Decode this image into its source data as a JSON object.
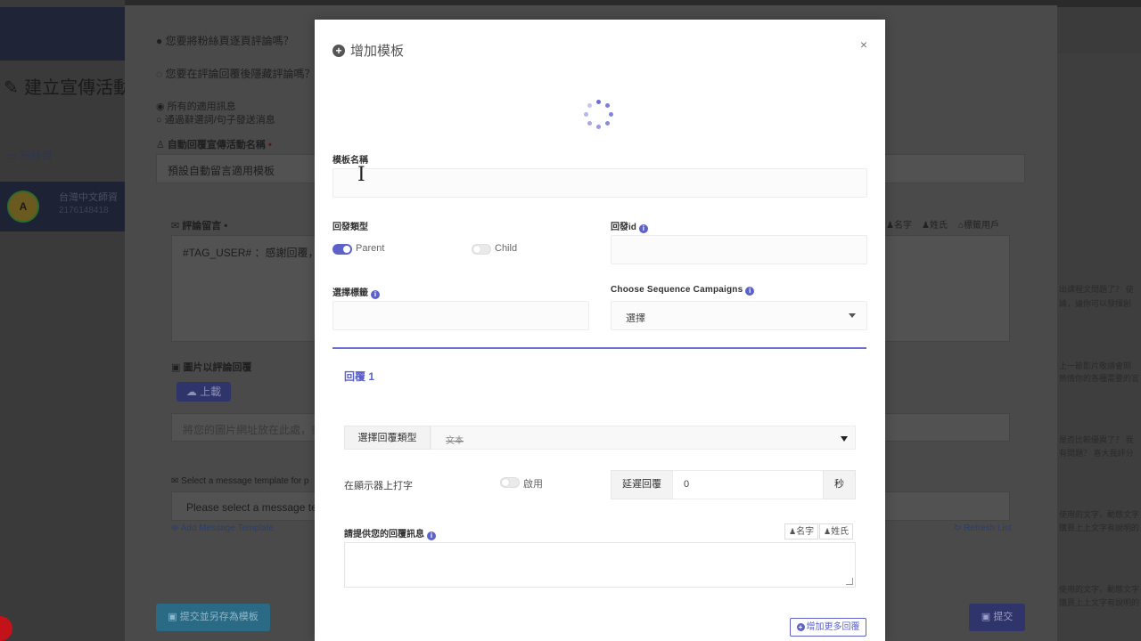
{
  "background": {
    "page_title": "建立宣傳活動",
    "fanpage_label": "粉絲頁",
    "account": {
      "initial": "A",
      "name": "台灣中文師資",
      "id": "2176148418"
    },
    "q_hide_reply": "您要在評論回覆後隱藏評論嗎？",
    "q_reply_page": "您要將粉絲頁逐頁評論嗎？",
    "radio_all": "所有的適用訊息",
    "radio_keyword": "通過辭選詞/句子發送消息",
    "campaign_name_label": "自動回覆宣傳活動名稱",
    "campaign_name_value": "預設自動留言適用模板",
    "comment_label": "評論留言",
    "comment_value": "#TAG_USER# ：感謝回覆，請",
    "tag_buttons": [
      "名字",
      "姓氏",
      "標籤用戶"
    ],
    "image_reply_label": "圖片以評論回覆",
    "upload_label": "上載",
    "image_url_placeholder": "將您的圖片網址放在此處，或",
    "template_label": "Select a message template for p",
    "template_placeholder": "Please select a message temp",
    "add_template_link": "Add Message Template",
    "refresh_link": "Refresh List",
    "save_as_template_button": "提交並另存為模板",
    "submit_button": "提交",
    "right_snippets": [
      "出課程文問題了？ 使",
      "論，讓你可以發揮創",
      "上一節影片敬請會期",
      "熱情你的各種需要的言",
      "是否比較優異了？ 我",
      "有問題？ 喜大我評分",
      "使用的文字，動態文字",
      "購買上上文字有說明的",
      "使用的文字，動態文字",
      "購買上上文字有說明的"
    ]
  },
  "modal": {
    "title": "增加模板",
    "close_label": "×",
    "template_name_label": "模板名稱",
    "template_name_value": "",
    "reply_type_label": "回發類型",
    "parent_label": "Parent",
    "child_label": "Child",
    "reply_id_label": "回發id",
    "select_tag_label": "選擇標籤",
    "sequence_label": "Choose Sequence Campaigns",
    "sequence_value": "選擇",
    "reply_heading": "回覆 1",
    "choose_reply_type_label": "選擇回覆類型",
    "choose_reply_type_value": "文本",
    "typing_label": "在顯示器上打字",
    "typing_toggle_label": "啟用",
    "delay_label": "延遲回覆",
    "delay_value": "0",
    "delay_unit": "秒",
    "provide_msg_label": "請提供您的回覆訊息",
    "first_name_tag": "名字",
    "last_name_tag": "姓氏",
    "add_more_label": "增加更多回覆"
  },
  "colors": {
    "accent": "#5d62c9",
    "overlay": "#4a4a4a",
    "modal_bg": "#ffffff"
  }
}
